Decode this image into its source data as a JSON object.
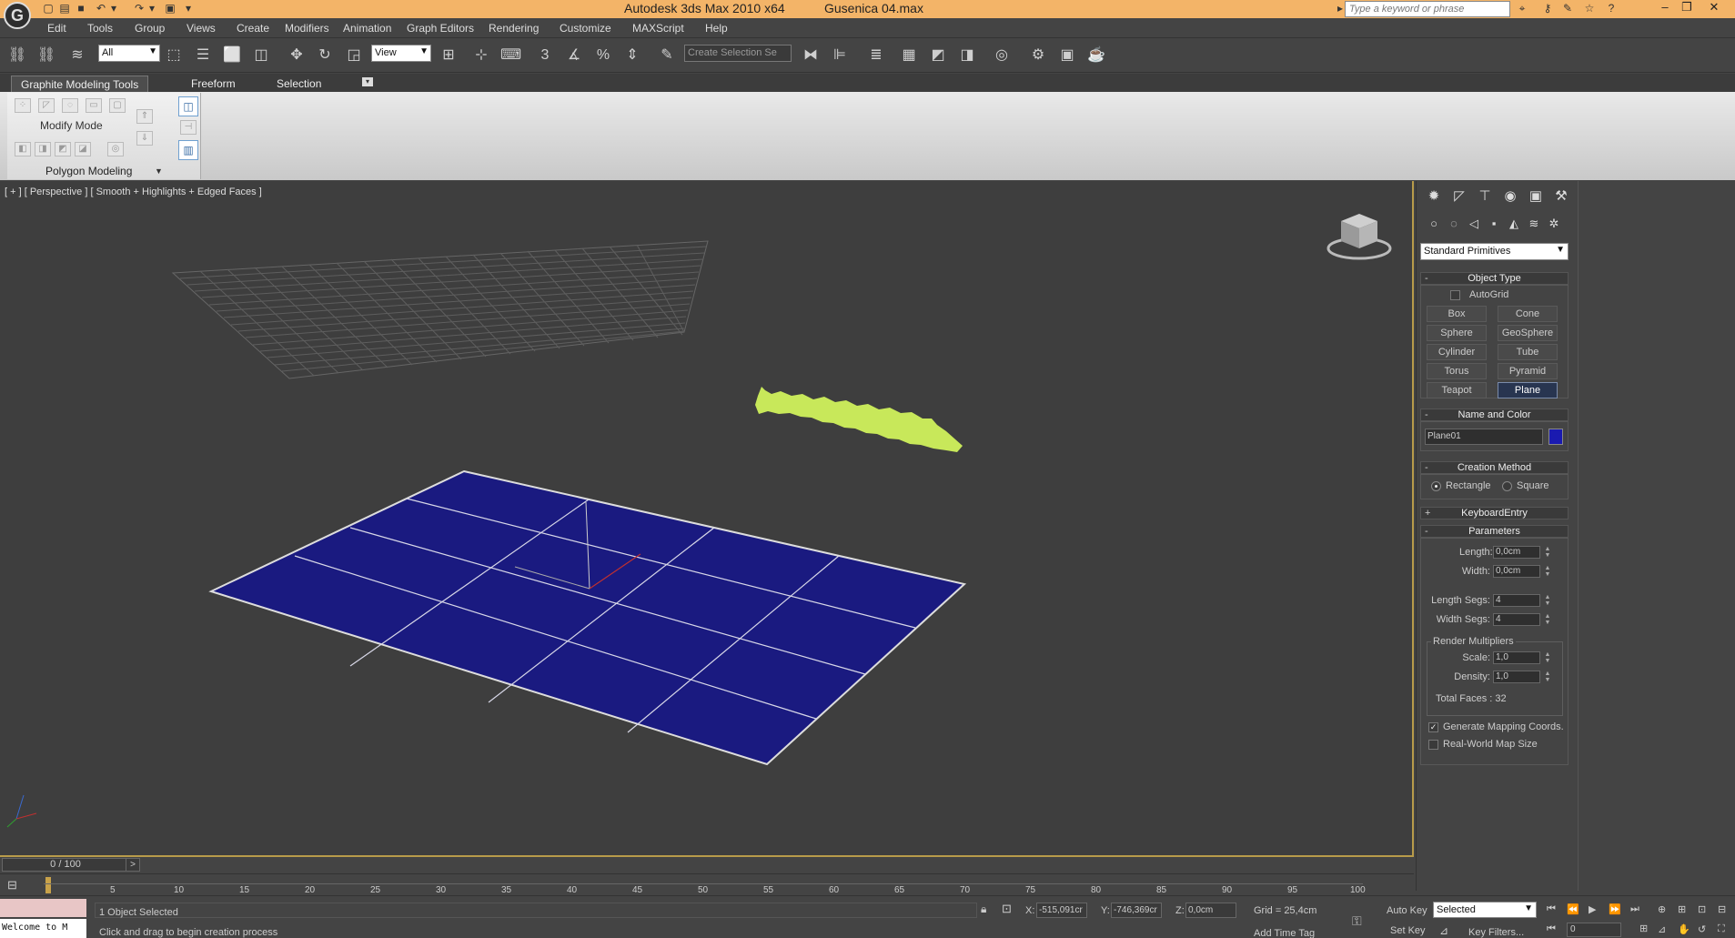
{
  "app": {
    "title": "Autodesk 3ds Max  2010 x64",
    "file": "Gusenica 04.max",
    "search_placeholder": "Type a keyword or phrase",
    "logo_letter": "G"
  },
  "menu": [
    "Edit",
    "Tools",
    "Group",
    "Views",
    "Create",
    "Modifiers",
    "Animation",
    "Graph Editors",
    "Rendering",
    "Customize",
    "MAXScript",
    "Help"
  ],
  "toolbar": {
    "selection_filter": "All",
    "ref_coord": "View",
    "named_selection_placeholder": "Create Selection Se",
    "snap_label": "3"
  },
  "ribbon": {
    "tabs": [
      "Graphite Modeling Tools",
      "Freeform",
      "Selection"
    ],
    "modify_mode": "Modify Mode",
    "polygon_modeling": "Polygon Modeling"
  },
  "viewport": {
    "label": "[ + ] [ Perspective ] [ Smooth + Highlights + Edged Faces ]",
    "plane_color": "#1a1a80",
    "caterpillar_color": "#c8e85a"
  },
  "command_panel": {
    "category": "Standard Primitives",
    "object_type": {
      "header": "Object Type",
      "autogrid": "AutoGrid",
      "buttons": [
        "Box",
        "Cone",
        "Sphere",
        "GeoSphere",
        "Cylinder",
        "Tube",
        "Torus",
        "Pyramid",
        "Teapot",
        "Plane"
      ],
      "active": "Plane"
    },
    "name_color": {
      "header": "Name and Color",
      "name": "Plane01",
      "color": "#1a1ab0"
    },
    "creation_method": {
      "header": "Creation Method",
      "options": [
        "Rectangle",
        "Square"
      ],
      "selected": "Rectangle"
    },
    "keyboard_entry": {
      "header": "KeyboardEntry"
    },
    "parameters": {
      "header": "Parameters",
      "length_label": "Length:",
      "length": "0,0cm",
      "width_label": "Width:",
      "width": "0,0cm",
      "length_segs_label": "Length Segs:",
      "length_segs": "4",
      "width_segs_label": "Width Segs:",
      "width_segs": "4",
      "render_multipliers": "Render Multipliers",
      "scale_label": "Scale:",
      "scale": "1,0",
      "density_label": "Density:",
      "density": "1,0",
      "total_faces": "Total Faces : 32",
      "gen_mapping": "Generate Mapping Coords.",
      "real_world": "Real-World Map Size"
    }
  },
  "timeline": {
    "frame": "0 / 100",
    "ticks": [
      "5",
      "10",
      "15",
      "20",
      "25",
      "30",
      "35",
      "40",
      "45",
      "50",
      "55",
      "60",
      "65",
      "70",
      "75",
      "80",
      "85",
      "90",
      "95",
      "100"
    ]
  },
  "status": {
    "maxscript": "Welcome to M",
    "selected": "1 Object Selected",
    "prompt": "Click and drag to begin creation process",
    "x_label": "X:",
    "x": "-515,091cr",
    "y_label": "Y:",
    "y": "-746,369cr",
    "z_label": "Z:",
    "z": "0,0cm",
    "grid": "Grid = 25,4cm",
    "add_time_tag": "Add Time Tag",
    "auto_key": "Auto Key",
    "set_key": "Set Key",
    "selected_dropdown": "Selected",
    "key_filters": "Key Filters...",
    "frame_field": "0"
  }
}
